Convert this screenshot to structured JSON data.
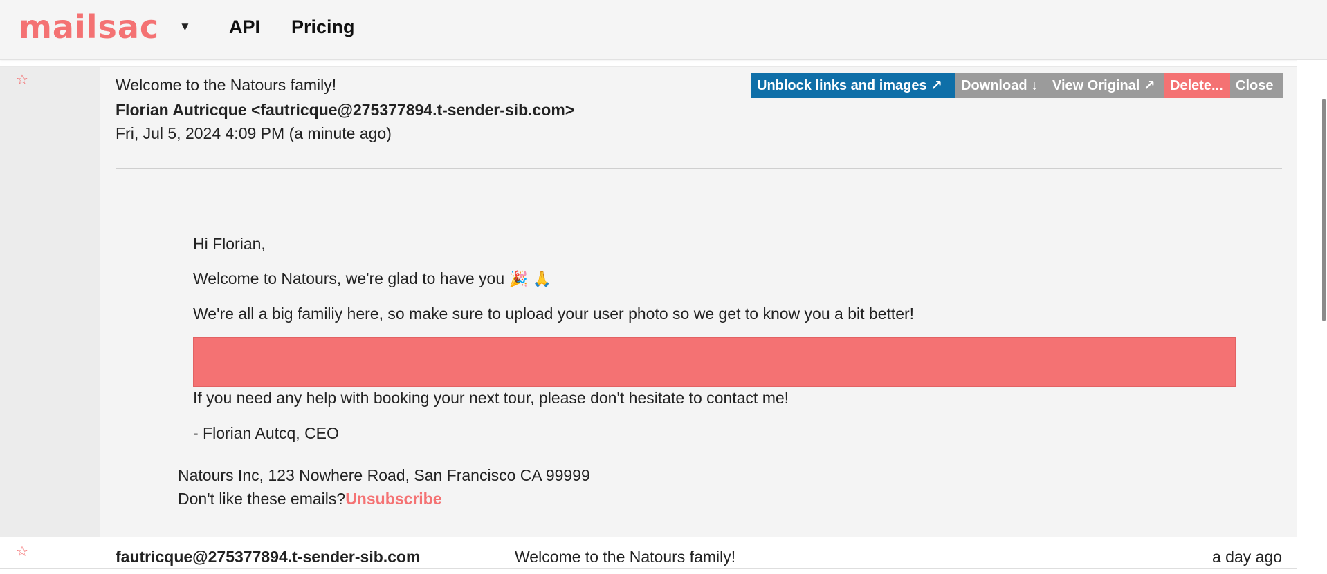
{
  "header": {
    "logo": "mailsac",
    "logo_menu_caret": "▼",
    "nav": {
      "api": "API",
      "pricing": "Pricing"
    }
  },
  "open_message": {
    "star": "☆",
    "subject": "Welcome to the Natours family!",
    "from": "Florian Autricque <fautricque@275377894.t-sender-sib.com>",
    "date": "Fri, Jul 5, 2024 4:09 PM (a minute ago)",
    "actions": {
      "unblock": "Unblock links and images ↗",
      "download": "Download ↓",
      "view_original": "View Original ↗",
      "delete": "Delete...",
      "close": "Close"
    },
    "body": {
      "greeting": "Hi Florian,",
      "welcome": "Welcome to Natours, we're glad to have you",
      "welcome_emojis": "🎉 🙏",
      "photo_note": "We're all a big familiy here, so make sure to upload your user photo so we get to know you a bit better!",
      "help": "If you need any help with booking your next tour, please don't hesitate to contact me!",
      "signoff": "- Florian Autcq, CEO"
    },
    "footer": {
      "address": "Natours Inc, 123 Nowhere Road, San Francisco CA 99999",
      "unsubscribe_prompt": "Don't like these emails?",
      "unsubscribe_link": "Unsubscribe"
    },
    "colors": {
      "accent": "#f47273",
      "primary_button": "#0f6fa8",
      "secondary_button": "#9b9b9b"
    }
  },
  "message_list": [
    {
      "star": "☆",
      "from": "fautricque@275377894.t-sender-sib.com",
      "subject": "Welcome to the Natours family!",
      "time": "a day ago"
    }
  ]
}
